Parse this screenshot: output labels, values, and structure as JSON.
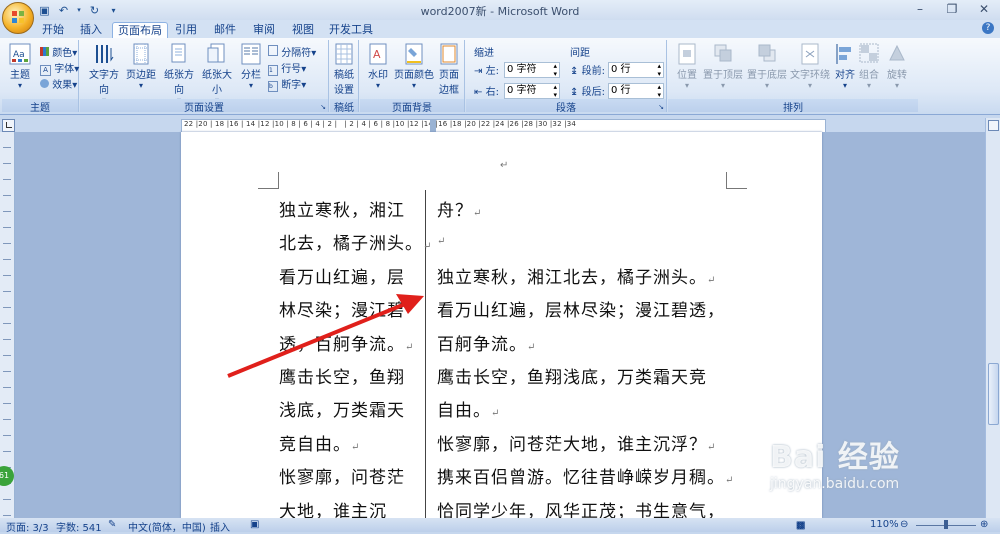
{
  "window": {
    "title": "word2007新 - Microsoft Word",
    "qat_undo_label": "↶",
    "qat_redo_label": "↻"
  },
  "tabs": [
    "开始",
    "插入",
    "页面布局",
    "引用",
    "邮件",
    "审阅",
    "视图",
    "开发工具"
  ],
  "ribbon": {
    "theme_group": {
      "label": "主题",
      "btn": "主题",
      "colors": "颜色",
      "fonts": "字体",
      "effects": "效果"
    },
    "page_setup": {
      "label": "页面设置",
      "text_dir": "文字方向",
      "margins": "页边距",
      "orientation": "纸张方向",
      "size": "纸张大小",
      "columns": "分栏",
      "breaks": "分隔符",
      "line_numbers": "行号",
      "hyphenation": "断字"
    },
    "manuscript": {
      "label": "稿纸",
      "btn_line1": "稿纸",
      "btn_line2": "设置"
    },
    "page_background": {
      "label": "页面背景",
      "watermark": "水印",
      "page_color": "页面颜色",
      "border_line1": "页面",
      "border_line2": "边框"
    },
    "paragraph": {
      "label": "段落",
      "indent": "缩进",
      "left": "左:",
      "right": "右:",
      "left_val": "0 字符",
      "right_val": "0 字符",
      "spacing": "间距",
      "before": "段前:",
      "after": "段后:",
      "before_val": "0 行",
      "after_val": "0 行"
    },
    "arrange": {
      "label": "排列",
      "position": "位置",
      "bring_front": "置于顶层",
      "send_back": "置于底层",
      "text_wrap": "文字环绕",
      "align": "对齐",
      "group": "组合",
      "rotate": "旋转"
    }
  },
  "ruler_numbers": "22 |20 | 18 |16 | 14 |12 |10 | 8 | 6 | 4 | 2 |   | 2 | 4 | 6 | 8 |10 |12 |14 |16 |18 |20 |22 |24 |26 |28 |30 |32 |34",
  "document": {
    "top_mark": "↵",
    "left_col": [
      "独立寒秋，湘江",
      "北去，橘子洲头。",
      "看万山红遍，层",
      "林尽染；漫江碧",
      "透，百舸争流。",
      "鹰击长空，鱼翔",
      "浅底，万类霜天",
      "竞自由。",
      "怅寥廓，问苍茫",
      "大地，谁主沉"
    ],
    "right_col": [
      "舟？",
      "",
      "独立寒秋，湘江北去，橘子洲头。",
      "看万山红遍，层林尽染；漫江碧透，",
      "百舸争流。",
      "鹰击长空，鱼翔浅底，万类霜天竞",
      "自由。",
      "怅寥廓，问苍茫大地，谁主沉浮？",
      "携来百侣曾游。忆往昔峥嵘岁月稠。",
      "恰同学少年，风华正茂；书生意气，"
    ],
    "left_marks": [
      "",
      "↵",
      "",
      "",
      "↵",
      "",
      "",
      "↵",
      "",
      ""
    ],
    "right_marks": [
      "↵",
      "↵",
      "↵",
      "",
      "↵",
      "",
      "↵",
      "↵",
      "↵",
      ""
    ]
  },
  "status": {
    "page": "页面: 3/3",
    "words": "字数: 541",
    "language": "中文(简体，中国)",
    "insert": "插入",
    "zoom": "110%"
  },
  "badge": "61",
  "watermark": {
    "brand": "Bai 经验",
    "url": "jingyan.baidu.com"
  },
  "colors": {
    "arrow": "#e0201b",
    "accent": "#15428b"
  }
}
